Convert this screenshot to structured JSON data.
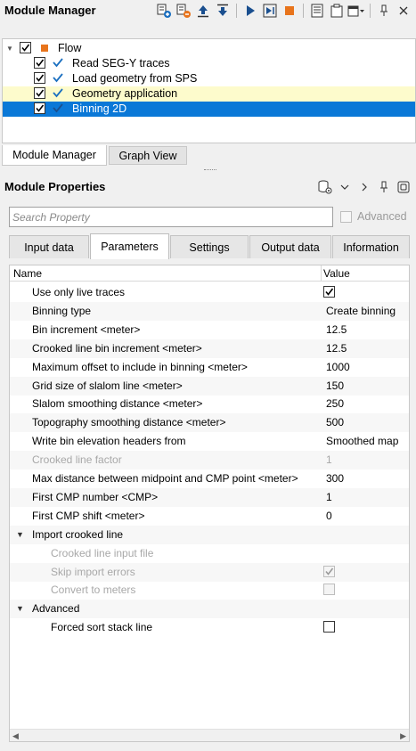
{
  "module_manager": {
    "title": "Module Manager",
    "toolbar_icons": [
      "add-module-icon",
      "remove-module-icon",
      "move-up-icon",
      "move-down-icon",
      "run-icon",
      "run-step-icon",
      "stop-icon",
      "list-icon",
      "clipboard-icon",
      "dropdown-icon",
      "pin-icon",
      "close-icon"
    ],
    "tree": {
      "root": {
        "label": "Flow",
        "checked": true
      },
      "items": [
        {
          "label": "Read SEG-Y traces",
          "checked": true,
          "state": "normal"
        },
        {
          "label": "Load geometry from SPS",
          "checked": true,
          "state": "normal"
        },
        {
          "label": "Geometry application",
          "checked": true,
          "state": "highlighted"
        },
        {
          "label": "Binning 2D",
          "checked": true,
          "state": "selected"
        }
      ]
    },
    "tabs": [
      {
        "label": "Module Manager",
        "active": true
      },
      {
        "label": "Graph View",
        "active": false
      }
    ]
  },
  "module_properties": {
    "title": "Module Properties",
    "search": {
      "placeholder": "Search Property",
      "value": ""
    },
    "advanced_label": "Advanced",
    "tabs": [
      {
        "label": "Input data",
        "active": false
      },
      {
        "label": "Parameters",
        "active": true
      },
      {
        "label": "Settings",
        "active": false
      },
      {
        "label": "Output data",
        "active": false
      },
      {
        "label": "Information",
        "active": false
      }
    ],
    "grid": {
      "col_name": "Name",
      "col_value": "Value",
      "rows": [
        {
          "name": "Use only live traces",
          "value": "",
          "checkbox": true,
          "checked": true,
          "disabled": false
        },
        {
          "name": "Binning type",
          "value": "Create binning",
          "disabled": false
        },
        {
          "name": "Bin increment <meter>",
          "value": "12.5",
          "disabled": false
        },
        {
          "name": "Crooked line bin increment <meter>",
          "value": "12.5",
          "disabled": false
        },
        {
          "name": "Maximum offset to include in binning <meter>",
          "value": "1000",
          "disabled": false
        },
        {
          "name": "Grid size of slalom line <meter>",
          "value": "150",
          "disabled": false
        },
        {
          "name": "Slalom smoothing distance <meter>",
          "value": "250",
          "disabled": false
        },
        {
          "name": "Topography smoothing distance <meter>",
          "value": "500",
          "disabled": false
        },
        {
          "name": "Write bin elevation headers from",
          "value": "Smoothed map",
          "disabled": false
        },
        {
          "name": "Crooked line factor",
          "value": "1",
          "disabled": true
        },
        {
          "name": "Max distance between midpoint and CMP point <meter>",
          "value": "300",
          "disabled": false
        },
        {
          "name": "First CMP number <CMP>",
          "value": "1",
          "disabled": false
        },
        {
          "name": "First CMP shift <meter>",
          "value": "0",
          "disabled": false
        },
        {
          "name": "Import crooked line",
          "group": true
        },
        {
          "name": "Crooked line input file",
          "value": "",
          "disabled": true,
          "child": true
        },
        {
          "name": "Skip import errors",
          "checkbox": true,
          "checked": true,
          "disabled": true,
          "child": true
        },
        {
          "name": "Convert to meters",
          "checkbox": true,
          "checked": false,
          "disabled": true,
          "child": true
        },
        {
          "name": "Advanced",
          "group": true
        },
        {
          "name": "Forced sort stack line",
          "checkbox": true,
          "checked": false,
          "disabled": false,
          "child": true
        }
      ]
    }
  },
  "colors": {
    "selection": "#0a78d7",
    "highlight": "#fdfbcc",
    "check_blue": "#1a6fc0",
    "flow_icon": "#e8741c"
  }
}
